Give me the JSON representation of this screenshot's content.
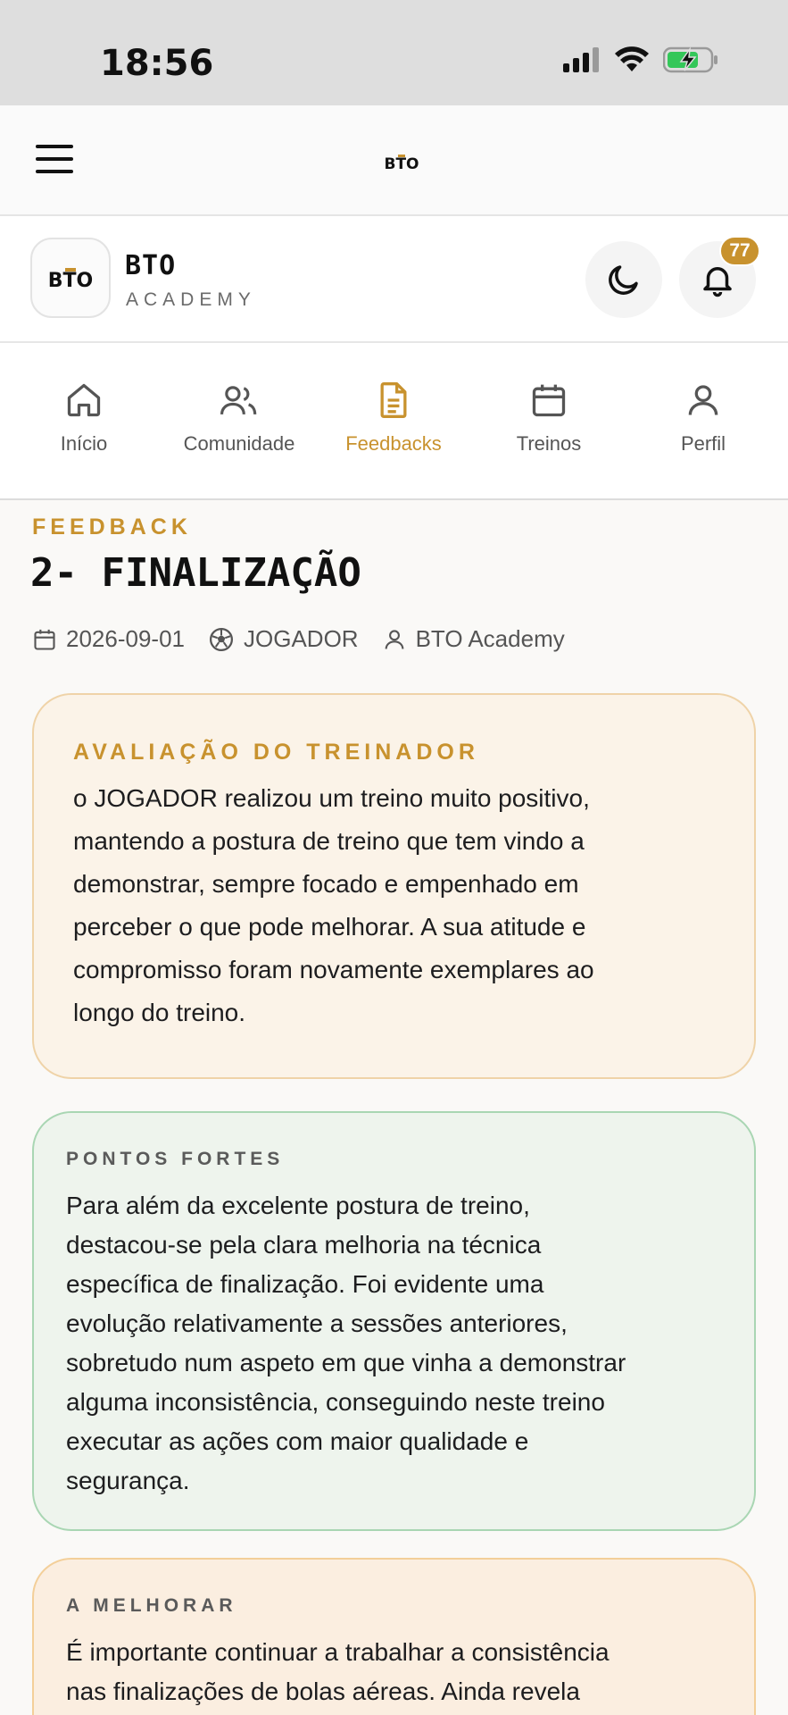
{
  "status_bar": {
    "time": "18:56"
  },
  "brand": {
    "logo_text": "BTO",
    "name": "BTO",
    "subtitle": "ACADEMY",
    "notification_count": "77"
  },
  "nav": {
    "tabs": [
      {
        "label": "Início",
        "icon": "home-icon",
        "active": false
      },
      {
        "label": "Comunidade",
        "icon": "users-icon",
        "active": false
      },
      {
        "label": "Feedbacks",
        "icon": "document-icon",
        "active": true
      },
      {
        "label": "Treinos",
        "icon": "calendar-icon",
        "active": false
      },
      {
        "label": "Perfil",
        "icon": "user-icon",
        "active": false
      }
    ]
  },
  "page": {
    "eyebrow": "FEEDBACK",
    "title": "2- FINALIZAÇÃO",
    "meta": {
      "date": "2026-09-01",
      "role": "JOGADOR",
      "author": "BTO Academy"
    }
  },
  "coach_review": {
    "title": "AVALIAÇÃO DO TREINADOR",
    "lines": [
      "o JOGADOR realizou um treino muito positivo,",
      "mantendo a postura de treino que tem vindo a",
      "demonstrar, sempre focado e empenhado em",
      "perceber o que pode melhorar. A sua atitude e",
      "compromisso foram novamente exemplares ao",
      "longo do treino."
    ]
  },
  "strengths": {
    "title": "PONTOS FORTES",
    "lines": [
      "Para além da excelente postura de treino,",
      "destacou-se pela clara melhoria na técnica",
      "específica de finalização. Foi evidente uma",
      "evolução relativamente a sessões anteriores,",
      "sobretudo num aspeto em que vinha a demonstrar",
      "alguma inconsistência, conseguindo neste treino",
      "executar as ações com maior qualidade e",
      "segurança."
    ]
  },
  "to_improve": {
    "title": "A MELHORAR",
    "lines": [
      "É importante continuar a trabalhar a consistência",
      "nas finalizações de bolas aéreas. Ainda revela"
    ]
  },
  "colors": {
    "accent": "#c8922e",
    "coach_card_bg": "#fbf3e8",
    "strengths_card_bg": "#eef4ed",
    "improve_card_bg": "#fbeee0"
  }
}
